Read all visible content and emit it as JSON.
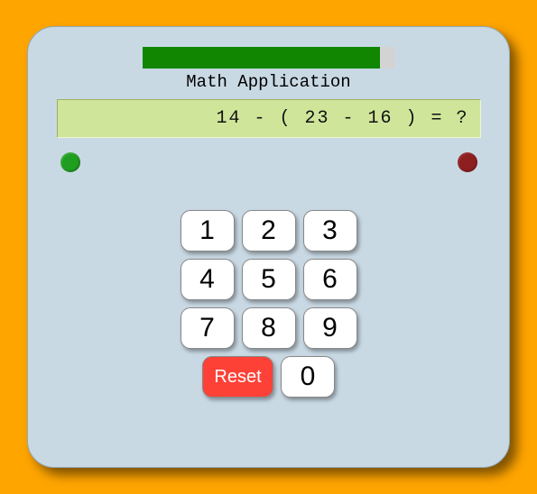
{
  "title": "Math Application",
  "progress": {
    "percent": 94
  },
  "display": "14 - ( 23 - 16 ) = ?",
  "led": {
    "green": true,
    "red": true
  },
  "keypad": {
    "k1": "1",
    "k2": "2",
    "k3": "3",
    "k4": "4",
    "k5": "5",
    "k6": "6",
    "k7": "7",
    "k8": "8",
    "k9": "9",
    "k0": "0",
    "reset": "Reset"
  }
}
